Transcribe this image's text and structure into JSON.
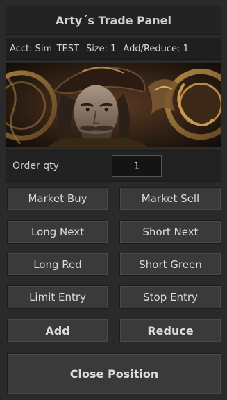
{
  "title": "Arty´s Trade Panel",
  "info": {
    "account": "Acct: Sim_TEST",
    "size": "Size: 1",
    "add_reduce": "Add/Reduce: 1"
  },
  "banner": {
    "icon": "pirate-portrait-image"
  },
  "order_qty": {
    "label": "Order qty",
    "value": "1"
  },
  "buttons": {
    "market_buy": "Market Buy",
    "market_sell": "Market Sell",
    "long_next": "Long Next",
    "short_next": "Short Next",
    "long_red": "Long Red",
    "short_green": "Short Green",
    "limit_entry": "Limit Entry",
    "stop_entry": "Stop Entry",
    "add": "Add",
    "reduce": "Reduce",
    "close_position": "Close Position"
  },
  "colors": {
    "background": "#2a2a2a",
    "button": "#3a3a3a",
    "text": "#dcdcdc"
  }
}
